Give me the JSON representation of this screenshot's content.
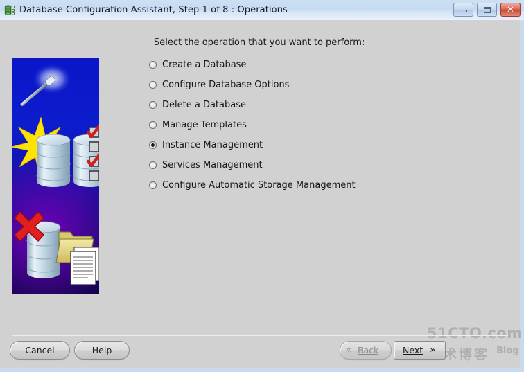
{
  "window": {
    "title": "Database Configuration Assistant, Step 1 of 8 : Operations",
    "icon": "database-server-icon",
    "controls": {
      "minimize": "–",
      "maximize": "□",
      "close": "✕"
    }
  },
  "content": {
    "heading": "Select the operation that you want to perform:",
    "options": [
      {
        "label": "Create a Database",
        "selected": false
      },
      {
        "label": "Configure Database Options",
        "selected": false
      },
      {
        "label": "Delete a Database",
        "selected": false
      },
      {
        "label": "Manage Templates",
        "selected": false
      },
      {
        "label": "Instance Management",
        "selected": true
      },
      {
        "label": "Services Management",
        "selected": false
      },
      {
        "label": "Configure Automatic Storage Management",
        "selected": false
      }
    ],
    "illustration": {
      "name": "dbca-wizard-illustration",
      "elements": "magic-wand, starburst, database-cylinders, checklist, red-x, folder, documents"
    }
  },
  "footer": {
    "cancel": "Cancel",
    "help": "Help",
    "back": {
      "label": "Back",
      "mnemonic": "B",
      "chevron": "«",
      "enabled": false
    },
    "next": {
      "label": "Next",
      "mnemonic": "N",
      "chevron": "»",
      "enabled": true
    }
  },
  "watermark": {
    "main": "51CTO.com",
    "sub": "技术博客",
    "blog": "Blog"
  },
  "colors": {
    "titlebar": "#c9dcf2",
    "client_bg": "#d1d1d1",
    "window_border": "#c9d9ee",
    "close_button": "#c9472f",
    "art_blue": "#0d1ccd",
    "art_purple": "#7800be",
    "check_red": "#d01f1f",
    "star_yellow": "#ffe400"
  }
}
